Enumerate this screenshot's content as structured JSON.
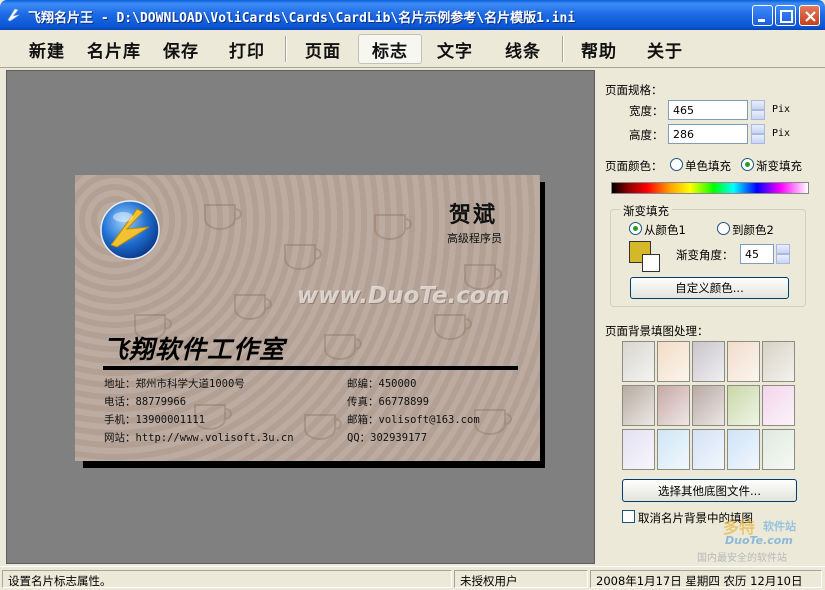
{
  "window": {
    "title": "飞翔名片王 - D:\\DOWNLOAD\\VoliCards\\Cards\\CardLib\\名片示例参考\\名片模版1.ini",
    "colors": {
      "titlebar": "#0a55d2",
      "close": "#c8401c"
    }
  },
  "toolbar": {
    "items": [
      {
        "label": "新建"
      },
      {
        "label": "名片库"
      },
      {
        "label": "保存"
      },
      {
        "label": "打印"
      },
      {
        "label": "页面"
      },
      {
        "label": "标志",
        "active": true
      },
      {
        "label": "文字"
      },
      {
        "label": "线条"
      },
      {
        "label": "帮助"
      },
      {
        "label": "关于"
      }
    ]
  },
  "card": {
    "name": "贺斌",
    "role": "高级程序员",
    "watermark": "www.DuoTe.com",
    "company": "飞翔软件工作室",
    "info": [
      "地址：郑州市科学大道1000号",
      "电话：88779966",
      "手机：13900001111",
      "网站：http://www.volisoft.3u.cn",
      "邮编：450000",
      "传真：66778899",
      "邮箱：volisoft@163.com",
      "QQ：302939177"
    ]
  },
  "panel": {
    "page_size_label": "页面规格：",
    "width_label": "宽度：",
    "width_value": "465",
    "height_label": "高度：",
    "height_value": "286",
    "unit": "Pix",
    "page_color_label": "页面颜色：",
    "solid_fill": "单色填充",
    "gradient_fill": "渐变填充",
    "gradient_group_title": "渐变填充",
    "from_color": "从颜色1",
    "to_color": "到颜色2",
    "gradient_angle_label": "渐变角度：",
    "gradient_angle_value": "45",
    "custom_color_button": "自定义颜色...",
    "bg_fill_label": "页面背景填图处理：",
    "choose_other_button": "选择其他底图文件...",
    "cancel_fill_label": "取消名片背景中的填图",
    "thumbnail_colors": [
      "#d9d6d0",
      "#f3dcc4",
      "#c9c5cc",
      "#f2dccb",
      "#d7d2c4",
      "#b8aba2",
      "#c6a9a6",
      "#b9a9a4",
      "#c9d8a8",
      "#f3d5ec",
      "#e4e0f3",
      "#cfe6f5",
      "#d3e2f5",
      "#cfe3f7",
      "#dfeadd"
    ]
  },
  "watermark_logo": {
    "line1": "多特",
    "line2": "软件站",
    "line3": "DuoTe.com",
    "line4": "国内最安全的软件站"
  },
  "statusbar": {
    "message": "设置名片标志属性。",
    "license": "未授权用户",
    "date": "2008年1月17日  星期四  农历  12月10日"
  }
}
